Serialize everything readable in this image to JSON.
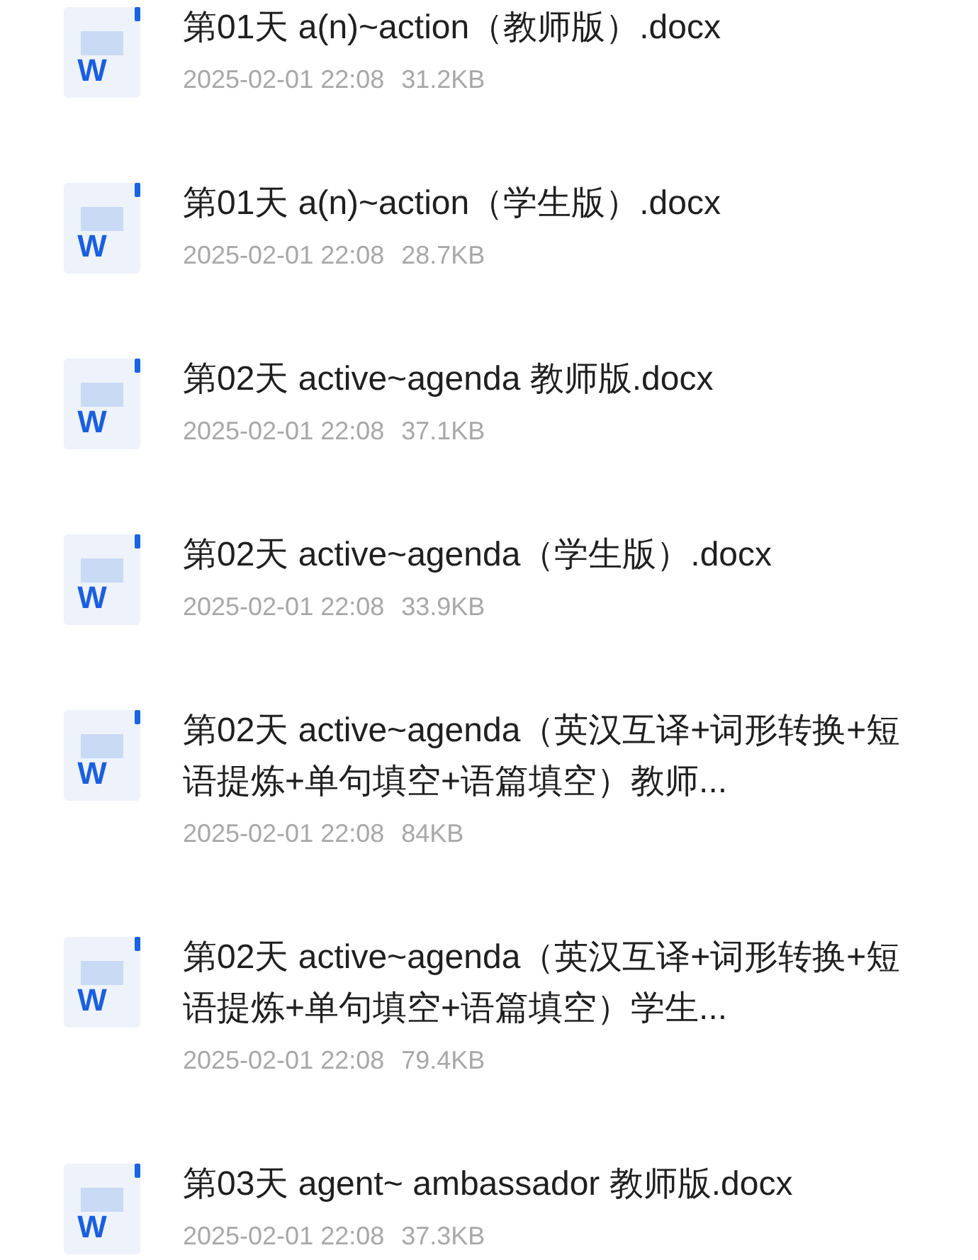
{
  "files": [
    {
      "icon_label": "W",
      "name": "第01天 a(n)~action（教师版）.docx",
      "date": "2025-02-01 22:08",
      "size": "31.2KB"
    },
    {
      "icon_label": "W",
      "name": "第01天 a(n)~action（学生版）.docx",
      "date": "2025-02-01 22:08",
      "size": "28.7KB"
    },
    {
      "icon_label": "W",
      "name": "第02天 active~agenda 教师版.docx",
      "date": "2025-02-01 22:08",
      "size": "37.1KB"
    },
    {
      "icon_label": "W",
      "name": "第02天 active~agenda（学生版）.docx",
      "date": "2025-02-01 22:08",
      "size": "33.9KB"
    },
    {
      "icon_label": "W",
      "name": "第02天 active~agenda（英汉互译+词形转换+短语提炼+单句填空+语篇填空）教师...",
      "date": "2025-02-01 22:08",
      "size": "84KB"
    },
    {
      "icon_label": "W",
      "name": "第02天 active~agenda（英汉互译+词形转换+短语提炼+单句填空+语篇填空）学生...",
      "date": "2025-02-01 22:08",
      "size": "79.4KB"
    },
    {
      "icon_label": "W",
      "name": "第03天 agent~ ambassador 教师版.docx",
      "date": "2025-02-01 22:08",
      "size": "37.3KB"
    }
  ]
}
